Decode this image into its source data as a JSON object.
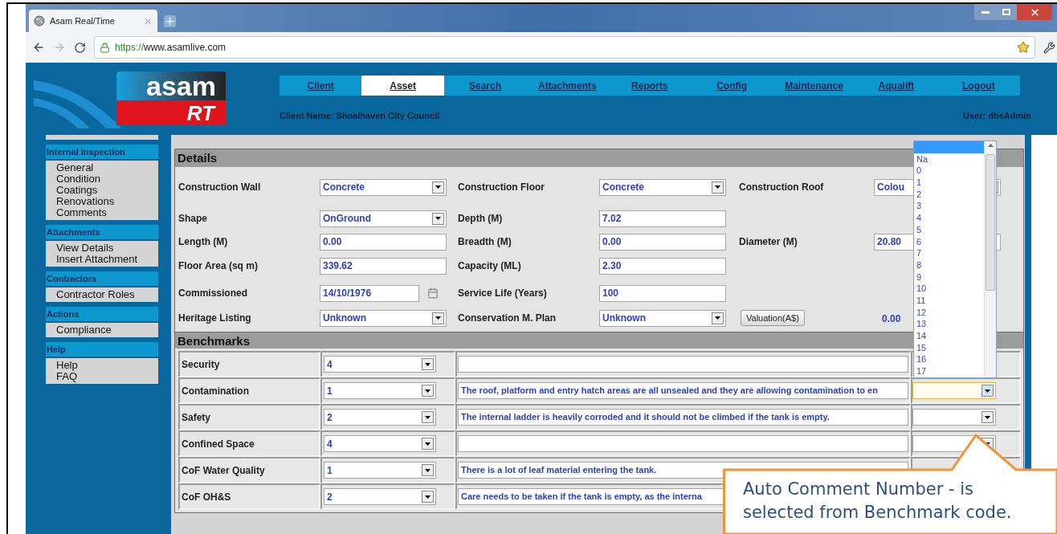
{
  "browser": {
    "tab": {
      "title": "Asam Real/Time"
    },
    "url": {
      "scheme": "https://",
      "rest": "www.asamlive.com"
    }
  },
  "logo": {
    "name": "asam",
    "badge": "RT"
  },
  "nav": [
    {
      "label": "Client",
      "selected": false
    },
    {
      "label": "Asset",
      "selected": true
    },
    {
      "label": "Search",
      "selected": false
    },
    {
      "label": "Attachments",
      "selected": false
    },
    {
      "label": "Reports",
      "selected": false
    },
    {
      "label": "Config",
      "selected": false
    },
    {
      "label": "Maintenance",
      "selected": false
    },
    {
      "label": "Aqualift",
      "selected": false
    },
    {
      "label": "Logout",
      "selected": false
    }
  ],
  "client_name": "Client Name: Shoalhaven City Council",
  "user": "User: dbsAdmin",
  "sidebar": [
    {
      "title": "Internal Inspection",
      "items": [
        "General",
        "Condition",
        "Coatings",
        "Renovations",
        "Comments"
      ]
    },
    {
      "title": "Attachments",
      "items": [
        "View Details",
        "Insert Attachment"
      ]
    },
    {
      "title": "Contractors",
      "items": [
        "Contractor Roles"
      ]
    },
    {
      "title": "Actions",
      "items": [
        "Compliance"
      ]
    },
    {
      "title": "Help",
      "items": [
        "Help",
        "FAQ"
      ]
    }
  ],
  "details": {
    "title": "Details",
    "rows": [
      [
        {
          "label": "Construction Wall",
          "kind": "select",
          "value": "Concrete"
        },
        {
          "label": "Construction Floor",
          "kind": "select",
          "value": "Concrete"
        },
        {
          "label": "Construction Roof",
          "kind": "select",
          "value": "Colou"
        }
      ],
      [
        {
          "label": "Shape",
          "kind": "select",
          "value": "OnGround"
        },
        {
          "label": "Depth (M)",
          "kind": "text",
          "value": "7.02"
        }
      ],
      [
        {
          "label": "Length (M)",
          "kind": "text",
          "value": "0.00"
        },
        {
          "label": "Breadth (M)",
          "kind": "text",
          "value": "0.00"
        },
        {
          "label": "Diameter (M)",
          "kind": "text",
          "value": "20.80"
        }
      ],
      [
        {
          "label": "Floor Area (sq m)",
          "kind": "text",
          "value": "339.62"
        },
        {
          "label": "Capacity (ML)",
          "kind": "text",
          "value": "2.30"
        }
      ],
      [
        {
          "label": "Commissioned",
          "kind": "date",
          "value": "14/10/1976"
        },
        {
          "label": "Service Life (Years)",
          "kind": "text",
          "value": "100"
        }
      ],
      [
        {
          "label": "Heritage Listing",
          "kind": "select",
          "value": "Unknown"
        },
        {
          "label": "Conservation M. Plan",
          "kind": "select",
          "value": "Unknown"
        },
        {
          "label": "Valuation(A$)",
          "kind": "button",
          "value": "0.00"
        }
      ]
    ]
  },
  "benchmarks": {
    "title": "Benchmarks",
    "rows": [
      {
        "name": "Security",
        "code": "4"
      },
      {
        "name": "Contamination",
        "code": "1",
        "comment": "The roof, platform and entry hatch areas are all unsealed and they are allowing contamination to en",
        "auto_open": true
      },
      {
        "name": "Safety",
        "code": "2",
        "comment": "The internal ladder is heavily corroded and it should not be climbed if the tank is empty.",
        "auto_open": false
      },
      {
        "name": "Confined Space",
        "code": "4",
        "auto_open": false
      },
      {
        "name": "CoF Water Quality",
        "code": "1",
        "comment": "There is a lot of leaf material entering the tank."
      },
      {
        "name": "CoF OH&S",
        "code": "2",
        "comment": "Care needs to be taken if the tank is empty, as the interna"
      }
    ]
  },
  "auto_comment_dropdown": {
    "options": [
      {
        "selected": true
      },
      {
        "label": "Na",
        "selected": false
      },
      {
        "label": "0",
        "selected": false
      },
      {
        "label": "1",
        "selected": false
      },
      {
        "label": "2",
        "selected": false
      },
      {
        "label": "3",
        "selected": false
      },
      {
        "label": "4",
        "selected": false
      },
      {
        "label": "5",
        "selected": false
      },
      {
        "label": "6",
        "selected": false
      },
      {
        "label": "7",
        "selected": false
      },
      {
        "label": "8",
        "selected": false
      },
      {
        "label": "9",
        "selected": false
      },
      {
        "label": "10",
        "selected": false
      },
      {
        "label": "11",
        "selected": false
      },
      {
        "label": "12",
        "selected": false
      },
      {
        "label": "13",
        "selected": false
      },
      {
        "label": "14",
        "selected": false
      },
      {
        "label": "15",
        "selected": false
      },
      {
        "label": "16",
        "selected": false
      },
      {
        "label": "17",
        "selected": false
      }
    ]
  },
  "callout": {
    "text": "Auto Comment Number - is selected from Benchmark code."
  }
}
